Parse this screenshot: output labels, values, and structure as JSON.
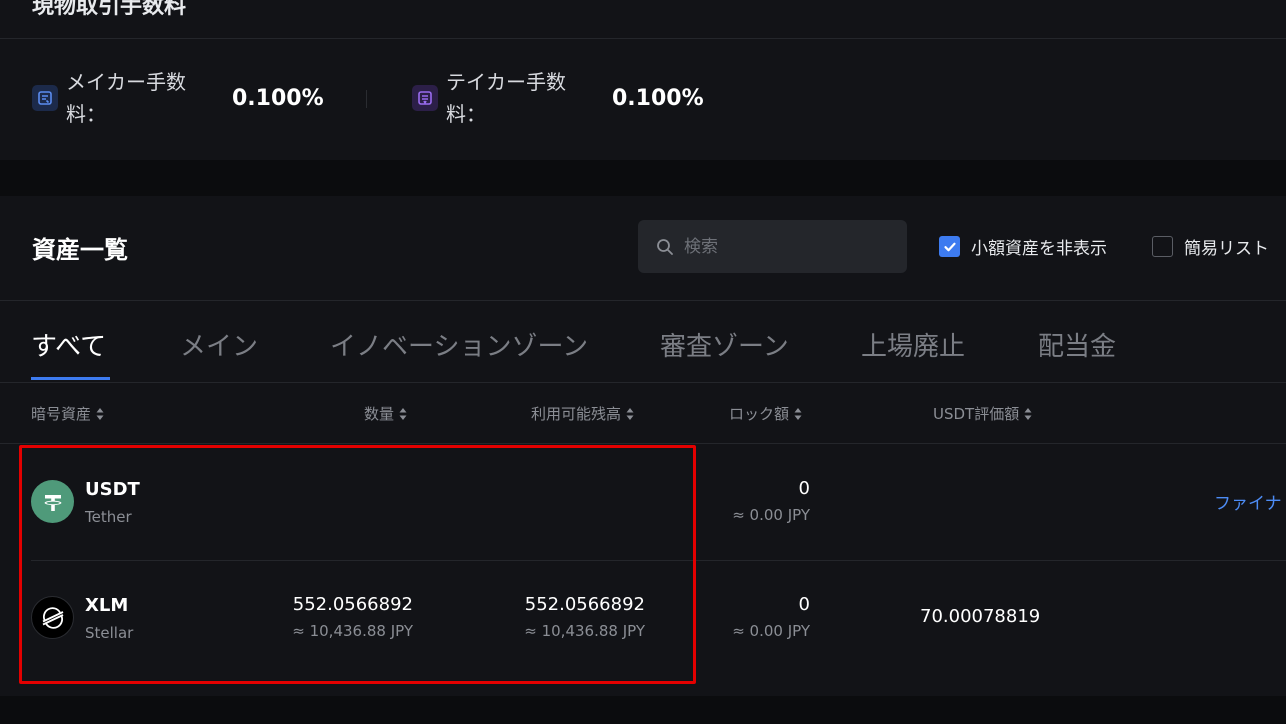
{
  "fees": {
    "title": "現物取引手数料",
    "maker": {
      "label": "メイカー手数料：",
      "value": "0.100%"
    },
    "taker": {
      "label": "テイカー手数料：",
      "value": "0.100%"
    }
  },
  "assets": {
    "title": "資産一覧",
    "search": {
      "placeholder": "検索",
      "value": ""
    },
    "hide_small": {
      "label": "小額資産を非表示",
      "checked": true
    },
    "simple_list": {
      "label": "簡易リスト",
      "checked": false
    },
    "tabs": [
      {
        "label": "すべて",
        "active": true
      },
      {
        "label": "メイン",
        "active": false
      },
      {
        "label": "イノベーションゾーン",
        "active": false
      },
      {
        "label": "審査ゾーン",
        "active": false
      },
      {
        "label": "上場廃止",
        "active": false
      },
      {
        "label": "配当金",
        "active": false
      }
    ],
    "columns": [
      "暗号資産",
      "数量",
      "利用可能残高",
      "ロック額",
      "USDT評価額"
    ],
    "rows": [
      {
        "symbol": "USDT",
        "name": "Tether",
        "locked": "0",
        "locked_jpy": "≈ 0.00 JPY",
        "action": "ファイナ"
      },
      {
        "symbol": "XLM",
        "name": "Stellar",
        "quantity": "552.0566892",
        "quantity_jpy": "≈ 10,436.88 JPY",
        "available": "552.0566892",
        "available_jpy": "≈ 10,436.88 JPY",
        "locked": "0",
        "locked_jpy": "≈ 0.00 JPY",
        "usdt_value": "70.00078819"
      }
    ]
  },
  "colors": {
    "accent": "#3d7bf0",
    "highlight": "#e30000",
    "usdt": "#4f9a7a"
  }
}
